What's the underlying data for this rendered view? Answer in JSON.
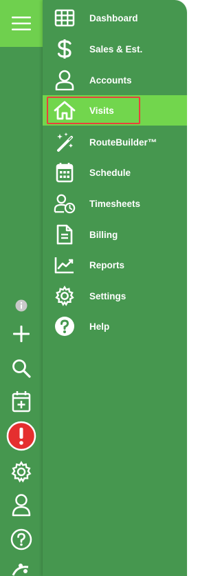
{
  "nav": {
    "items": [
      {
        "label": "Dashboard",
        "icon": "grid-icon"
      },
      {
        "label": "Sales & Est.",
        "icon": "dollar-icon"
      },
      {
        "label": "Accounts",
        "icon": "user-icon"
      },
      {
        "label": "Visits",
        "icon": "home-icon",
        "active": true
      },
      {
        "label": "RouteBuilder™",
        "icon": "magic-wand-icon"
      },
      {
        "label": "Schedule",
        "icon": "calendar-icon"
      },
      {
        "label": "Timesheets",
        "icon": "user-clock-icon"
      },
      {
        "label": "Billing",
        "icon": "document-icon"
      },
      {
        "label": "Reports",
        "icon": "chart-line-icon"
      },
      {
        "label": "Settings",
        "icon": "gear-icon"
      },
      {
        "label": "Help",
        "icon": "question-circle-icon"
      }
    ]
  },
  "rail": {
    "icons": [
      "menu-icon",
      "info-icon",
      "plus-icon",
      "search-icon",
      "calendar-add-icon",
      "alert-icon",
      "gear-icon",
      "user-icon",
      "help-icon",
      "partial-icon"
    ]
  },
  "colors": {
    "rail_bg": "#46974f",
    "hamburger_bg": "#6fd04e",
    "active_bg": "#72d64d",
    "focus_border": "#e8413c",
    "alert_red": "#e52f2f"
  }
}
